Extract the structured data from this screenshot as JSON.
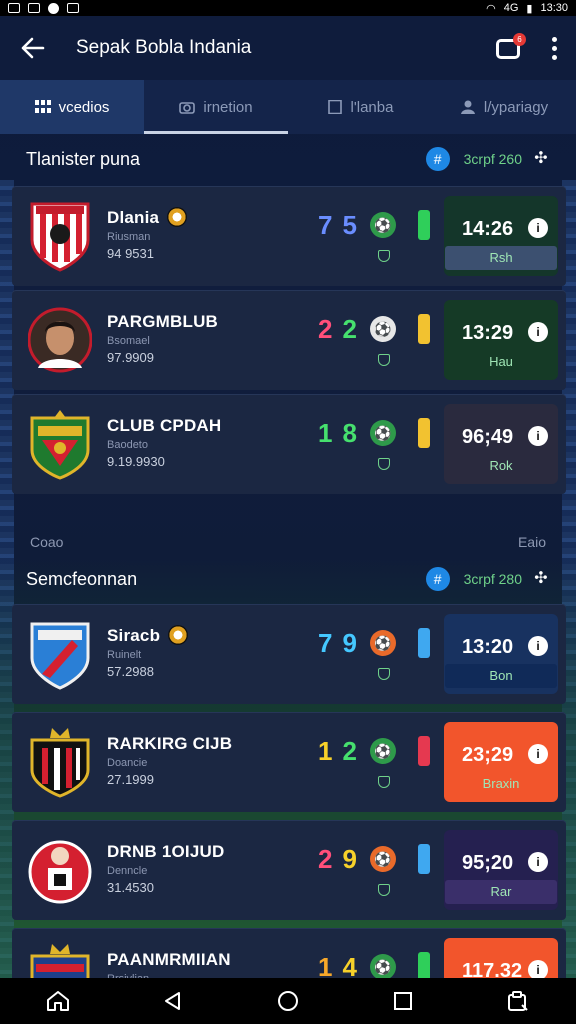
{
  "status_bar": {
    "time": "13:30",
    "signal": "4G"
  },
  "app": {
    "title": "Sepak Bobla Indania"
  },
  "notification": {
    "badge": "6"
  },
  "tabs": [
    {
      "label": "vcedios",
      "icon": "grid-icon",
      "active": true
    },
    {
      "label": "irnetion",
      "icon": "camera-icon",
      "active": false
    },
    {
      "label": "l'lanba",
      "icon": "square-icon",
      "active": false
    },
    {
      "label": "l/ypariagy",
      "icon": "user-icon",
      "active": false
    }
  ],
  "sections": [
    {
      "title": "Tlanister puna",
      "badge_icon": "#",
      "meta": "3crpf 260",
      "matches": [
        {
          "name": "Dlania",
          "sub": "Riusman",
          "num": "94 9531",
          "score": [
            "7",
            "5"
          ],
          "score_colors": [
            "#6a8dff",
            "#6a8dff"
          ],
          "chip_color": "#2e9a4a",
          "bar_color": "#2fcf5a",
          "time": "14:26",
          "status": "Rsh",
          "box_bg": "#14362a",
          "status_bg": "#3c5070",
          "crest": "stripes-red",
          "ball": true
        },
        {
          "name": "PARGMBLUB",
          "sub": "Bsomael",
          "num": "97.9909",
          "score": [
            "2",
            "2"
          ],
          "score_colors": [
            "#ff4f7a",
            "#46e06e"
          ],
          "chip_color": "#e7e7e7",
          "bar_color": "#f2c230",
          "time": "13:29",
          "status": "Hau",
          "box_bg": "#153a26",
          "status_bg": "#153a26",
          "crest": "player-photo",
          "ball": false
        },
        {
          "name": "CLUB CPDAH",
          "sub": "Baodeto",
          "num": "9.19.9930",
          "score": [
            "1",
            "8"
          ],
          "score_colors": [
            "#46e06e",
            "#46e06e"
          ],
          "chip_color": "#2e9a4a",
          "bar_color": "#f2c230",
          "time": "96;49",
          "status": "Rok",
          "box_bg": "#2a2a3e",
          "status_bg": "#2a2a3e",
          "crest": "green-shield",
          "ball": false
        }
      ]
    },
    {
      "title": "Semcfeonnan",
      "badge_icon": "#",
      "meta": "3crpf 280",
      "matches": [
        {
          "name": "Siracb",
          "sub": "Ruinelt",
          "num": "57.2988",
          "score": [
            "7",
            "9"
          ],
          "score_colors": [
            "#45c8ff",
            "#45c8ff"
          ],
          "chip_color": "#e96a2a",
          "bar_color": "#3fa8f0",
          "time": "13:20",
          "status": "Bon",
          "box_bg": "#183260",
          "status_bg": "#102a58",
          "crest": "blue-shield",
          "ball": true
        },
        {
          "name": "RARKIRG CIJB",
          "sub": "Doancie",
          "num": "27.1999",
          "score": [
            "1",
            "2"
          ],
          "score_colors": [
            "#f7d12a",
            "#46e06e"
          ],
          "chip_color": "#2e9a4a",
          "bar_color": "#e53950",
          "time": "23;29",
          "status": "Braxin",
          "box_bg": "#f2552c",
          "status_bg": "#f2552c",
          "crest": "striped-crown",
          "ball": false
        },
        {
          "name": "DRNB 1OIJUD",
          "sub": "Denncle",
          "num": "31.4530",
          "score": [
            "2",
            "9"
          ],
          "score_colors": [
            "#ff4f7a",
            "#f7d12a"
          ],
          "chip_color": "#e96a2a",
          "bar_color": "#3fa8f0",
          "time": "95;20",
          "status": "Rar",
          "box_bg": "#252050",
          "status_bg": "#3a2f6a",
          "crest": "red-round",
          "ball": false
        },
        {
          "name": "PAANMRMIIAN",
          "sub": "Rrsivlian",
          "num": "",
          "score": [
            "1",
            "4"
          ],
          "score_colors": [
            "#f7a82a",
            "#f7d12a"
          ],
          "chip_color": "#2e9a4a",
          "bar_color": "#2fcf5a",
          "time": "117.32",
          "status": "",
          "box_bg": "#f2552c",
          "status_bg": "#f2552c",
          "crest": "blue-crown",
          "ball": false
        }
      ]
    }
  ],
  "divider": {
    "left": "Coao",
    "right": "Eaio"
  }
}
